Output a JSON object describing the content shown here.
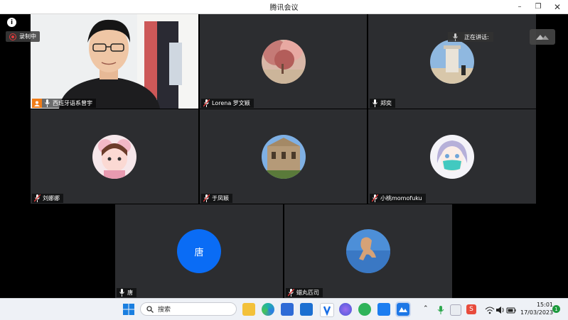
{
  "window": {
    "title": "腾讯会议"
  },
  "overlay": {
    "recording_label": "录制中",
    "speaking_label": "正在讲话:"
  },
  "participants": [
    {
      "name": "西班牙语系曾宇"
    },
    {
      "name": "Lorena 罗文颖"
    },
    {
      "name": "郑奕"
    },
    {
      "name": "刘娜娜"
    },
    {
      "name": "于凤颖"
    },
    {
      "name": "小桃momofuku"
    },
    {
      "name": "唐",
      "avatar_text": "唐"
    },
    {
      "name": "蜡丸匹司"
    }
  ],
  "taskbar": {
    "search_placeholder": "搜索",
    "time": "15:01",
    "date": "17/03/2023",
    "notification_count": "1"
  },
  "colors": {
    "tile_bg": "#2c2d30",
    "accent_blue": "#0a6cf5",
    "muted_red": "#e03a3a",
    "orange_host": "#f07d18"
  }
}
